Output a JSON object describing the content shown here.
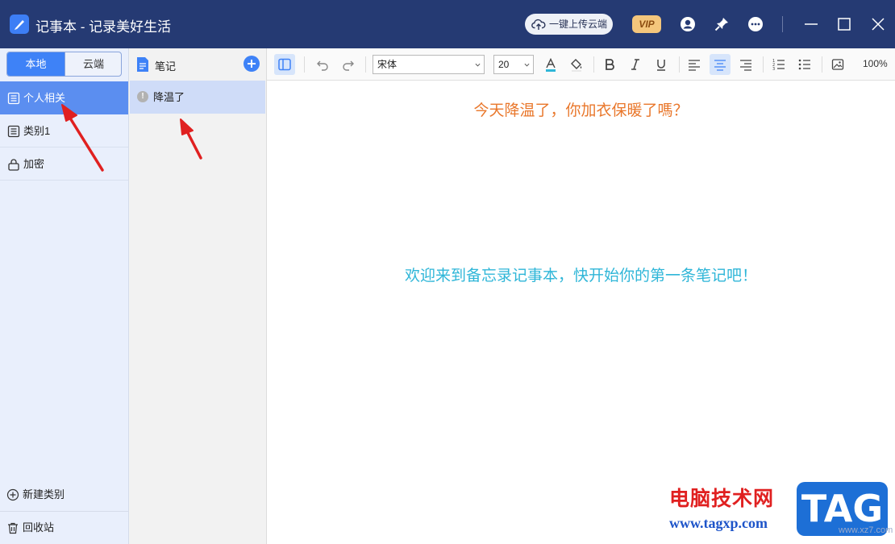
{
  "window": {
    "title": "记事本 - 记录美好生活",
    "upload_label": "一键上传云端",
    "vip_label": "VIP"
  },
  "sidebar": {
    "segment": {
      "local": "本地",
      "cloud": "云端"
    },
    "categories": [
      {
        "label": "个人相关",
        "icon": "list-icon",
        "active": true
      },
      {
        "label": "类别1",
        "icon": "list-icon",
        "active": false
      },
      {
        "label": "加密",
        "icon": "lock-icon",
        "active": false
      }
    ],
    "new_category": "新建类别",
    "recycle_bin": "回收站"
  },
  "notes": {
    "header": "笔记",
    "items": [
      {
        "title": "降温了",
        "icon": "info-icon",
        "selected": true
      }
    ]
  },
  "toolbar": {
    "font_family": "宋体",
    "font_size": "20",
    "zoom": "100%"
  },
  "editor": {
    "line1": "今天降温了，你加衣保暖了嗎？",
    "line2": "欢迎来到备忘录记事本，快开始你的第一条笔记吧！"
  },
  "watermark": {
    "site_name": "电脑技术网",
    "site_url": "www.tagxp.com",
    "tag": "TAG",
    "small": "www.xz7.com"
  },
  "colors": {
    "titlebar": "#253a73",
    "accent": "#3e82f7",
    "active_category": "#5b8ef0",
    "line1": "#e9772b",
    "line2": "#2fb6d8",
    "arrow": "#e02020"
  }
}
